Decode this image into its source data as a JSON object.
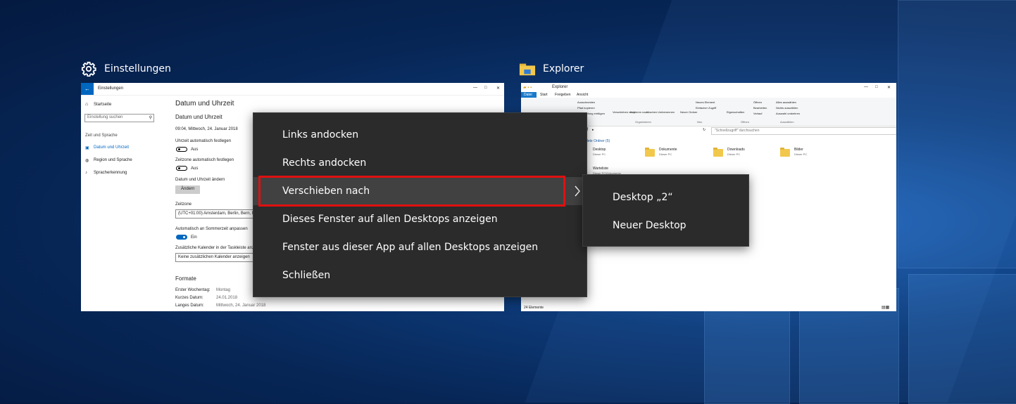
{
  "windows": {
    "settings": {
      "caption": "Einstellungen",
      "titlebar": "Einstellungen",
      "nav_home": "Startseite",
      "search_placeholder": "Einstellung suchen",
      "section": "Zeit und Sprache",
      "nav_items": [
        "Datum und Uhrzeit",
        "Region und Sprache",
        "Spracherkennung"
      ],
      "page_title": "Datum und Uhrzeit",
      "sub_title": "Datum und Uhrzeit",
      "current_datetime": "09:04, Mittwoch, 24. Januar 2018",
      "auto_time_label": "Uhrzeit automatisch festlegen",
      "auto_time_state": "Aus",
      "auto_tz_label": "Zeitzone automatisch festlegen",
      "auto_tz_state": "Aus",
      "change_label": "Datum und Uhrzeit ändern",
      "change_button": "Ändern",
      "tz_label": "Zeitzone",
      "tz_value": "(UTC+01:00) Amsterdam, Berlin, Bern, Rom",
      "dst_label": "Automatisch an Sommerzeit anpassen",
      "dst_state": "Ein",
      "extra_cal_label": "Zusätzliche Kalender in der Taskleiste anzeigen",
      "extra_cal_value": "Keine zusätzlichen Kalender anzeigen",
      "formats_title": "Formate",
      "formats": [
        {
          "k": "Erster Wochentag:",
          "v": "Montag"
        },
        {
          "k": "Kurzes Datum:",
          "v": "24.01.2018"
        },
        {
          "k": "Langes Datum:",
          "v": "Mittwoch, 24. Januar 2018"
        }
      ]
    },
    "explorer": {
      "caption": "Explorer",
      "titlebar": "Explorer",
      "ribbon_tabs": [
        "Datei",
        "Start",
        "Freigeben",
        "Ansicht"
      ],
      "ribbon_small": [
        "Ausschneiden",
        "Pfad kopieren",
        "Verknüpfung einfügen"
      ],
      "ribbon_buttons": [
        "Verschieben nach",
        "Kopieren nach",
        "Löschen",
        "Umbenennen",
        "Neuer Ordner"
      ],
      "ribbon_new": [
        "Neues Element",
        "Einfacher Zugriff"
      ],
      "ribbon_open": [
        "Eigenschaften",
        "Öffnen",
        "Bearbeiten",
        "Verlauf"
      ],
      "ribbon_select": [
        "Alles auswählen",
        "Nichts auswählen",
        "Auswahl umkehren"
      ],
      "ribbon_groups": [
        "Organisieren",
        "Neu",
        "Öffnen",
        "Auswählen"
      ],
      "search_placeholder": "\"Schnellzugriff\" durchsuchen",
      "address_fragment": "ff",
      "section_label": "Häufig verwendete Ordner (5)",
      "folders": [
        {
          "name": "Desktop",
          "sub": "Dieser PC"
        },
        {
          "name": "Dokumente",
          "sub": "Dieser PC"
        },
        {
          "name": "Downloads",
          "sub": "Dieser PC"
        },
        {
          "name": "Bilder",
          "sub": "Dieser PC"
        },
        {
          "name": "Warteliste",
          "sub": "Dieser PC\\Dokumente"
        }
      ],
      "status": "24 Elemente"
    }
  },
  "context_menu": {
    "items": [
      "Links andocken",
      "Rechts andocken",
      "Verschieben nach",
      "Dieses Fenster auf allen Desktops anzeigen",
      "Fenster aus dieser App auf allen Desktops anzeigen",
      "Schließen"
    ],
    "highlighted_index": 2
  },
  "submenu": {
    "items": [
      "Desktop „2“",
      "Neuer Desktop"
    ]
  },
  "colors": {
    "accent": "#0067c0",
    "menu_bg": "#2b2b2b",
    "menu_highlight": "#414141",
    "highlight_box": "#e01010"
  }
}
